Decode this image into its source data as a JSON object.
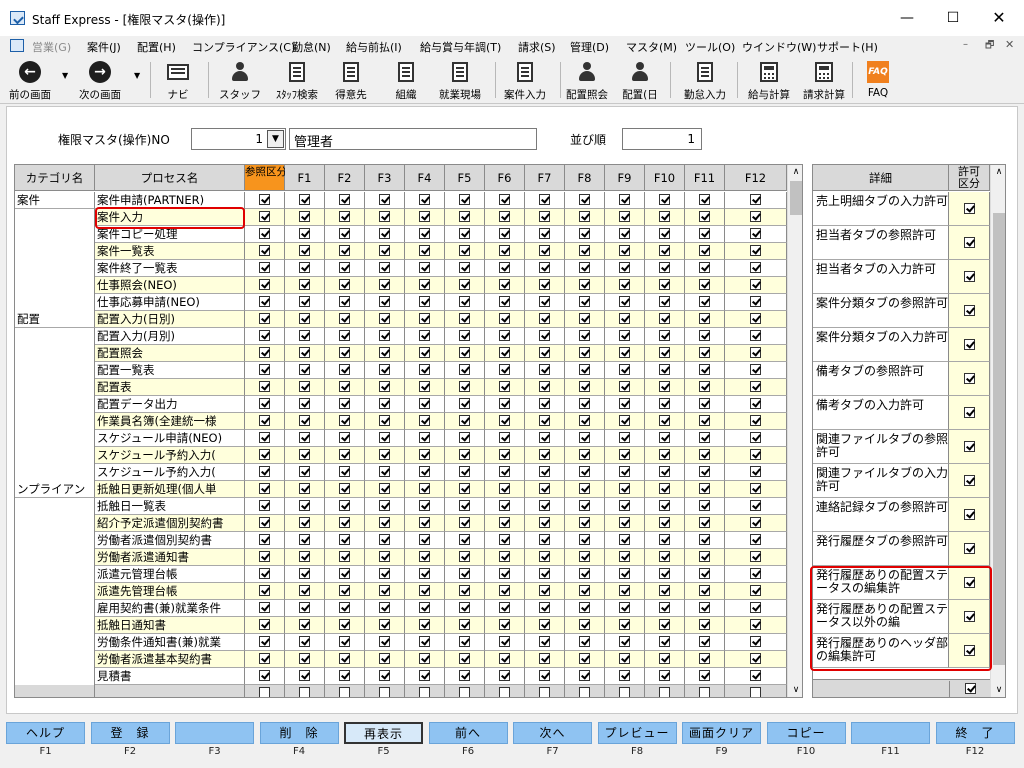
{
  "window": {
    "title": "Staff Express - [権限マスタ(操作)]",
    "min": "—",
    "max": "☐",
    "close": "✕"
  },
  "menu": {
    "items": [
      {
        "label": "営業(G)",
        "disabled": true
      },
      {
        "label": "案件(J)"
      },
      {
        "label": "配置(H)"
      },
      {
        "label": "コンプライアンス(C)"
      },
      {
        "label": "勤怠(N)"
      },
      {
        "label": "給与前払(I)"
      },
      {
        "label": "給与賞与年調(T)"
      },
      {
        "label": "請求(S)"
      },
      {
        "label": "管理(D)"
      },
      {
        "label": "マスタ(M)"
      },
      {
        "label": "ツール(O)"
      },
      {
        "label": "ウインドウ(W)"
      },
      {
        "label": "サポート(H)"
      }
    ],
    "mdi_min": "–",
    "mdi_restore": "🗗",
    "mdi_close": "✕"
  },
  "toolbar": {
    "items": [
      {
        "label": "前の画面",
        "icon": "back-arrow-icon"
      },
      {
        "label": "次の画面",
        "icon": "forward-arrow-icon"
      },
      {
        "label": "ナビ",
        "icon": "navi-icon"
      },
      {
        "label": "スタッフ",
        "icon": "staff-icon"
      },
      {
        "label": "ｽﾀｯﾌ検索",
        "icon": "staff-search-icon"
      },
      {
        "label": "得意先",
        "icon": "customer-icon"
      },
      {
        "label": "組織",
        "icon": "organization-icon"
      },
      {
        "label": "就業現場",
        "icon": "workplace-icon"
      },
      {
        "label": "案件入力",
        "icon": "case-input-icon"
      },
      {
        "label": "配置照会",
        "icon": "placement-inquiry-icon"
      },
      {
        "label": "配置(日",
        "icon": "placement-daily-icon"
      },
      {
        "label": "勤怠入力",
        "icon": "attendance-input-icon"
      },
      {
        "label": "給与計算",
        "icon": "payroll-icon"
      },
      {
        "label": "請求計算",
        "icon": "billing-icon"
      },
      {
        "label": "FAQ",
        "icon": "faq-icon"
      }
    ]
  },
  "form": {
    "no_label": "権限マスタ(操作)NO",
    "no_value": "1",
    "name_value": "管理者",
    "order_label": "並び順",
    "order_value": "1"
  },
  "grid": {
    "headers": [
      "カテゴリ名",
      "プロセス名",
      "参照区分",
      "F1",
      "F2",
      "F3",
      "F4",
      "F5",
      "F6",
      "F7",
      "F8",
      "F9",
      "F10",
      "F11",
      "F12"
    ],
    "rows": [
      {
        "category": "案件",
        "process": "案件申請(PARTNER)"
      },
      {
        "category": "",
        "process": "案件入力"
      },
      {
        "category": "",
        "process": "案件コピー処理"
      },
      {
        "category": "",
        "process": "案件一覧表"
      },
      {
        "category": "",
        "process": "案件終了一覧表"
      },
      {
        "category": "",
        "process": "仕事照会(NEO)"
      },
      {
        "category": "",
        "process": "仕事応募申請(NEO)"
      },
      {
        "category": "配置",
        "process": "配置入力(日別)"
      },
      {
        "category": "",
        "process": "配置入力(月別)"
      },
      {
        "category": "",
        "process": "配置照会"
      },
      {
        "category": "",
        "process": "配置一覧表"
      },
      {
        "category": "",
        "process": "配置表"
      },
      {
        "category": "",
        "process": "配置データ出力"
      },
      {
        "category": "",
        "process": "作業員名簿(全建統一様"
      },
      {
        "category": "",
        "process": "スケジュール申請(NEO)"
      },
      {
        "category": "",
        "process": "スケジュール予約入力("
      },
      {
        "category": "",
        "process": "スケジュール予約入力("
      },
      {
        "category": "ンプライアン",
        "process": "抵触日更新処理(個人単"
      },
      {
        "category": "",
        "process": "抵触日一覧表"
      },
      {
        "category": "",
        "process": "紹介予定派遣個別契約書"
      },
      {
        "category": "",
        "process": "労働者派遣個別契約書"
      },
      {
        "category": "",
        "process": "労働者派遣通知書"
      },
      {
        "category": "",
        "process": "派遣元管理台帳"
      },
      {
        "category": "",
        "process": "派遣先管理台帳"
      },
      {
        "category": "",
        "process": "雇用契約書(兼)就業条件"
      },
      {
        "category": "",
        "process": "抵触日通知書"
      },
      {
        "category": "",
        "process": "労働条件通知書(兼)就業"
      },
      {
        "category": "",
        "process": "労働者派遣基本契約書"
      },
      {
        "category": "",
        "process": "見積書"
      }
    ],
    "row_checked": true,
    "total_row_checked": false
  },
  "detail": {
    "headers": [
      "詳細",
      "許可区分"
    ],
    "items": [
      "売上明細タブの入力許可",
      "担当者タブの参照許可",
      "担当者タブの入力許可",
      "案件分類タブの参照許可",
      "案件分類タブの入力許可",
      "備考タブの参照許可",
      "備考タブの入力許可",
      "関連ファイルタブの参照許可",
      "関連ファイルタブの入力許可",
      "連絡記録タブの参照許可",
      "発行履歴タブの参照許可",
      "発行履歴ありの配置ステータスの編集許",
      "発行履歴ありの配置ステータス以外の編",
      "発行履歴ありのヘッダ部の編集許可"
    ],
    "checked": true
  },
  "fkeys": [
    {
      "label": "ヘルプ",
      "key": "F1"
    },
    {
      "label": "登　録",
      "key": "F2"
    },
    {
      "label": "",
      "key": "F3"
    },
    {
      "label": "削　除",
      "key": "F4"
    },
    {
      "label": "再表示",
      "key": "F5",
      "pressed": true
    },
    {
      "label": "前へ",
      "key": "F6"
    },
    {
      "label": "次へ",
      "key": "F7"
    },
    {
      "label": "プレビュー",
      "key": "F8"
    },
    {
      "label": "画面クリア",
      "key": "F9"
    },
    {
      "label": "コピー",
      "key": "F10"
    },
    {
      "label": "",
      "key": "F11"
    },
    {
      "label": "終　了",
      "key": "F12"
    }
  ],
  "colors": {
    "ref_header": "#f7941d",
    "row_alt": "#ffffdc",
    "fkey": "#8fc3f2",
    "highlight": "#e00000"
  }
}
